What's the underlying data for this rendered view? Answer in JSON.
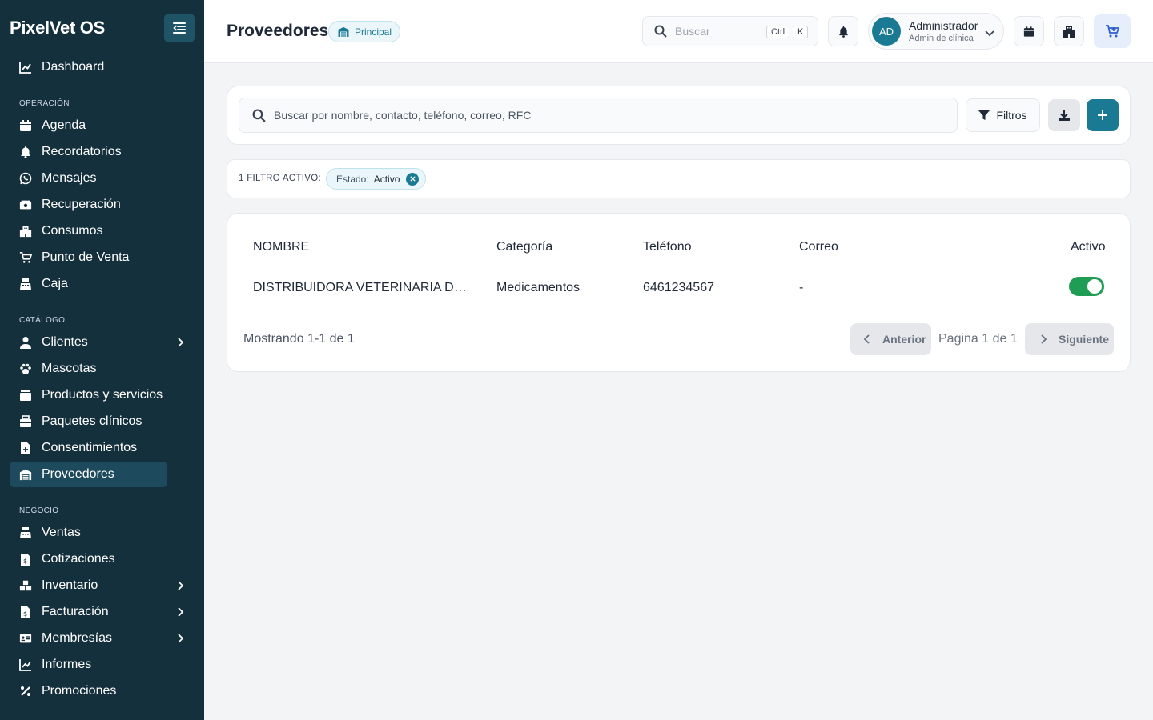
{
  "app": {
    "brand": "PixelVet OS"
  },
  "sidebar": {
    "top_item": {
      "label": "Dashboard",
      "icon": "chart-line-icon"
    },
    "sections": [
      {
        "label": "OPERACIÓN",
        "items": [
          {
            "label": "Agenda",
            "icon": "calendar-icon"
          },
          {
            "label": "Recordatorios",
            "icon": "bell-icon"
          },
          {
            "label": "Mensajes",
            "icon": "whatsapp-icon"
          },
          {
            "label": "Recuperación",
            "icon": "money-icon"
          },
          {
            "label": "Consumos",
            "icon": "building-icon"
          },
          {
            "label": "Punto de Venta",
            "icon": "cart-icon"
          },
          {
            "label": "Caja",
            "icon": "cash-register-icon"
          }
        ]
      },
      {
        "label": "CATÁLOGO",
        "items": [
          {
            "label": "Clientes",
            "icon": "user-icon",
            "expandable": true
          },
          {
            "label": "Mascotas",
            "icon": "paw-icon"
          },
          {
            "label": "Productos y servicios",
            "icon": "box-icon"
          },
          {
            "label": "Paquetes clínicos",
            "icon": "package-icon"
          },
          {
            "label": "Consentimientos",
            "icon": "file-medical-icon"
          },
          {
            "label": "Proveedores",
            "icon": "warehouse-icon",
            "active": true
          }
        ]
      },
      {
        "label": "NEGOCIO",
        "items": [
          {
            "label": "Ventas",
            "icon": "cash-register-icon"
          },
          {
            "label": "Cotizaciones",
            "icon": "file-invoice-icon"
          },
          {
            "label": "Inventario",
            "icon": "boxes-icon",
            "expandable": true
          },
          {
            "label": "Facturación",
            "icon": "invoice-dollar-icon",
            "expandable": true
          },
          {
            "label": "Membresías",
            "icon": "id-card-icon",
            "expandable": true
          },
          {
            "label": "Informes",
            "icon": "chart-line-icon"
          },
          {
            "label": "Promociones",
            "icon": "percent-icon"
          }
        ]
      }
    ]
  },
  "topbar": {
    "title": "Proveedores",
    "branch": "Principal",
    "search_placeholder": "Buscar",
    "kbd": [
      "Ctrl",
      "K"
    ],
    "user": {
      "initials": "AD",
      "name": "Administrador",
      "role": "Admin de clínica"
    }
  },
  "toolbar": {
    "search_placeholder": "Buscar por nombre, contacto, teléfono, correo, RFC",
    "filters_label": "Filtros"
  },
  "active_filters": {
    "label": "1 FILTRO ACTIVO:",
    "chip": {
      "key": "Estado:",
      "value": "Activo"
    }
  },
  "table": {
    "headers": [
      "NOMBRE",
      "Categoría",
      "Teléfono",
      "Correo",
      "Activo"
    ],
    "rows": [
      {
        "nombre": "DISTRIBUIDORA VETERINARIA DEL NOROESTE",
        "categoria": "Medicamentos",
        "telefono": "6461234567",
        "correo": "-",
        "activo": true
      }
    ]
  },
  "pagination": {
    "showing": "Mostrando 1-1 de 1",
    "prev": "Anterior",
    "page": "Pagina 1 de 1",
    "next": "Siguiente"
  },
  "colors": {
    "sidebar": "#15303d",
    "accent": "#1b7a93",
    "toggle_on": "#1f9d55"
  }
}
